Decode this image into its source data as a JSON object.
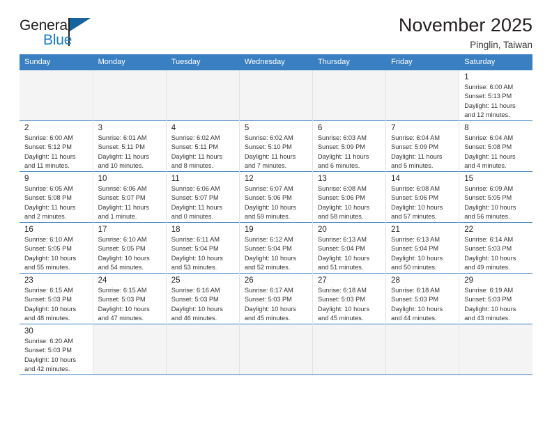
{
  "brand": {
    "name_top": "General",
    "name_bottom": "Blue",
    "accent_color": "#1c7fc4",
    "flag_color": "#15639f",
    "flag_icon": "flag-triangle-icon"
  },
  "header": {
    "title": "November 2025",
    "subtitle": "Pinglin, Taiwan"
  },
  "calendar": {
    "header_bg": "#3a7fc1",
    "header_text_color": "#ffffff",
    "weekdays": [
      "Sunday",
      "Monday",
      "Tuesday",
      "Wednesday",
      "Thursday",
      "Friday",
      "Saturday"
    ],
    "labels": {
      "sunrise": "Sunrise:",
      "sunset": "Sunset:",
      "daylight": "Daylight:"
    },
    "weeks": [
      [
        {
          "day": "",
          "detail": ""
        },
        {
          "day": "",
          "detail": ""
        },
        {
          "day": "",
          "detail": ""
        },
        {
          "day": "",
          "detail": ""
        },
        {
          "day": "",
          "detail": ""
        },
        {
          "day": "",
          "detail": ""
        },
        {
          "day": "1",
          "sunrise": "6:00 AM",
          "sunset": "5:13 PM",
          "daylight": "11 hours and 12 minutes.",
          "detail": "Sunrise: 6:00 AM\nSunset: 5:13 PM\nDaylight: 11 hours\nand 12 minutes."
        }
      ],
      [
        {
          "day": "2",
          "sunrise": "6:00 AM",
          "sunset": "5:12 PM",
          "daylight": "11 hours and 11 minutes.",
          "detail": "Sunrise: 6:00 AM\nSunset: 5:12 PM\nDaylight: 11 hours\nand 11 minutes."
        },
        {
          "day": "3",
          "sunrise": "6:01 AM",
          "sunset": "5:11 PM",
          "daylight": "11 hours and 10 minutes.",
          "detail": "Sunrise: 6:01 AM\nSunset: 5:11 PM\nDaylight: 11 hours\nand 10 minutes."
        },
        {
          "day": "4",
          "sunrise": "6:02 AM",
          "sunset": "5:11 PM",
          "daylight": "11 hours and 8 minutes.",
          "detail": "Sunrise: 6:02 AM\nSunset: 5:11 PM\nDaylight: 11 hours\nand 8 minutes."
        },
        {
          "day": "5",
          "sunrise": "6:02 AM",
          "sunset": "5:10 PM",
          "daylight": "11 hours and 7 minutes.",
          "detail": "Sunrise: 6:02 AM\nSunset: 5:10 PM\nDaylight: 11 hours\nand 7 minutes."
        },
        {
          "day": "6",
          "sunrise": "6:03 AM",
          "sunset": "5:09 PM",
          "daylight": "11 hours and 6 minutes.",
          "detail": "Sunrise: 6:03 AM\nSunset: 5:09 PM\nDaylight: 11 hours\nand 6 minutes."
        },
        {
          "day": "7",
          "sunrise": "6:04 AM",
          "sunset": "5:09 PM",
          "daylight": "11 hours and 5 minutes.",
          "detail": "Sunrise: 6:04 AM\nSunset: 5:09 PM\nDaylight: 11 hours\nand 5 minutes."
        },
        {
          "day": "8",
          "sunrise": "6:04 AM",
          "sunset": "5:08 PM",
          "daylight": "11 hours and 4 minutes.",
          "detail": "Sunrise: 6:04 AM\nSunset: 5:08 PM\nDaylight: 11 hours\nand 4 minutes."
        }
      ],
      [
        {
          "day": "9",
          "sunrise": "6:05 AM",
          "sunset": "5:08 PM",
          "daylight": "11 hours and 2 minutes.",
          "detail": "Sunrise: 6:05 AM\nSunset: 5:08 PM\nDaylight: 11 hours\nand 2 minutes."
        },
        {
          "day": "10",
          "sunrise": "6:06 AM",
          "sunset": "5:07 PM",
          "daylight": "11 hours and 1 minute.",
          "detail": "Sunrise: 6:06 AM\nSunset: 5:07 PM\nDaylight: 11 hours\nand 1 minute."
        },
        {
          "day": "11",
          "sunrise": "6:06 AM",
          "sunset": "5:07 PM",
          "daylight": "11 hours and 0 minutes.",
          "detail": "Sunrise: 6:06 AM\nSunset: 5:07 PM\nDaylight: 11 hours\nand 0 minutes."
        },
        {
          "day": "12",
          "sunrise": "6:07 AM",
          "sunset": "5:06 PM",
          "daylight": "10 hours and 59 minutes.",
          "detail": "Sunrise: 6:07 AM\nSunset: 5:06 PM\nDaylight: 10 hours\nand 59 minutes."
        },
        {
          "day": "13",
          "sunrise": "6:08 AM",
          "sunset": "5:06 PM",
          "daylight": "10 hours and 58 minutes.",
          "detail": "Sunrise: 6:08 AM\nSunset: 5:06 PM\nDaylight: 10 hours\nand 58 minutes."
        },
        {
          "day": "14",
          "sunrise": "6:08 AM",
          "sunset": "5:06 PM",
          "daylight": "10 hours and 57 minutes.",
          "detail": "Sunrise: 6:08 AM\nSunset: 5:06 PM\nDaylight: 10 hours\nand 57 minutes."
        },
        {
          "day": "15",
          "sunrise": "6:09 AM",
          "sunset": "5:05 PM",
          "daylight": "10 hours and 56 minutes.",
          "detail": "Sunrise: 6:09 AM\nSunset: 5:05 PM\nDaylight: 10 hours\nand 56 minutes."
        }
      ],
      [
        {
          "day": "16",
          "sunrise": "6:10 AM",
          "sunset": "5:05 PM",
          "daylight": "10 hours and 55 minutes.",
          "detail": "Sunrise: 6:10 AM\nSunset: 5:05 PM\nDaylight: 10 hours\nand 55 minutes."
        },
        {
          "day": "17",
          "sunrise": "6:10 AM",
          "sunset": "5:05 PM",
          "daylight": "10 hours and 54 minutes.",
          "detail": "Sunrise: 6:10 AM\nSunset: 5:05 PM\nDaylight: 10 hours\nand 54 minutes."
        },
        {
          "day": "18",
          "sunrise": "6:11 AM",
          "sunset": "5:04 PM",
          "daylight": "10 hours and 53 minutes.",
          "detail": "Sunrise: 6:11 AM\nSunset: 5:04 PM\nDaylight: 10 hours\nand 53 minutes."
        },
        {
          "day": "19",
          "sunrise": "6:12 AM",
          "sunset": "5:04 PM",
          "daylight": "10 hours and 52 minutes.",
          "detail": "Sunrise: 6:12 AM\nSunset: 5:04 PM\nDaylight: 10 hours\nand 52 minutes."
        },
        {
          "day": "20",
          "sunrise": "6:13 AM",
          "sunset": "5:04 PM",
          "daylight": "10 hours and 51 minutes.",
          "detail": "Sunrise: 6:13 AM\nSunset: 5:04 PM\nDaylight: 10 hours\nand 51 minutes."
        },
        {
          "day": "21",
          "sunrise": "6:13 AM",
          "sunset": "5:04 PM",
          "daylight": "10 hours and 50 minutes.",
          "detail": "Sunrise: 6:13 AM\nSunset: 5:04 PM\nDaylight: 10 hours\nand 50 minutes."
        },
        {
          "day": "22",
          "sunrise": "6:14 AM",
          "sunset": "5:03 PM",
          "daylight": "10 hours and 49 minutes.",
          "detail": "Sunrise: 6:14 AM\nSunset: 5:03 PM\nDaylight: 10 hours\nand 49 minutes."
        }
      ],
      [
        {
          "day": "23",
          "sunrise": "6:15 AM",
          "sunset": "5:03 PM",
          "daylight": "10 hours and 48 minutes.",
          "detail": "Sunrise: 6:15 AM\nSunset: 5:03 PM\nDaylight: 10 hours\nand 48 minutes."
        },
        {
          "day": "24",
          "sunrise": "6:15 AM",
          "sunset": "5:03 PM",
          "daylight": "10 hours and 47 minutes.",
          "detail": "Sunrise: 6:15 AM\nSunset: 5:03 PM\nDaylight: 10 hours\nand 47 minutes."
        },
        {
          "day": "25",
          "sunrise": "6:16 AM",
          "sunset": "5:03 PM",
          "daylight": "10 hours and 46 minutes.",
          "detail": "Sunrise: 6:16 AM\nSunset: 5:03 PM\nDaylight: 10 hours\nand 46 minutes."
        },
        {
          "day": "26",
          "sunrise": "6:17 AM",
          "sunset": "5:03 PM",
          "daylight": "10 hours and 45 minutes.",
          "detail": "Sunrise: 6:17 AM\nSunset: 5:03 PM\nDaylight: 10 hours\nand 45 minutes."
        },
        {
          "day": "27",
          "sunrise": "6:18 AM",
          "sunset": "5:03 PM",
          "daylight": "10 hours and 45 minutes.",
          "detail": "Sunrise: 6:18 AM\nSunset: 5:03 PM\nDaylight: 10 hours\nand 45 minutes."
        },
        {
          "day": "28",
          "sunrise": "6:18 AM",
          "sunset": "5:03 PM",
          "daylight": "10 hours and 44 minutes.",
          "detail": "Sunrise: 6:18 AM\nSunset: 5:03 PM\nDaylight: 10 hours\nand 44 minutes."
        },
        {
          "day": "29",
          "sunrise": "6:19 AM",
          "sunset": "5:03 PM",
          "daylight": "10 hours and 43 minutes.",
          "detail": "Sunrise: 6:19 AM\nSunset: 5:03 PM\nDaylight: 10 hours\nand 43 minutes."
        }
      ],
      [
        {
          "day": "30",
          "sunrise": "6:20 AM",
          "sunset": "5:03 PM",
          "daylight": "10 hours and 42 minutes.",
          "detail": "Sunrise: 6:20 AM\nSunset: 5:03 PM\nDaylight: 10 hours\nand 42 minutes."
        },
        {
          "day": "",
          "detail": ""
        },
        {
          "day": "",
          "detail": ""
        },
        {
          "day": "",
          "detail": ""
        },
        {
          "day": "",
          "detail": ""
        },
        {
          "day": "",
          "detail": ""
        },
        {
          "day": "",
          "detail": ""
        }
      ]
    ]
  }
}
